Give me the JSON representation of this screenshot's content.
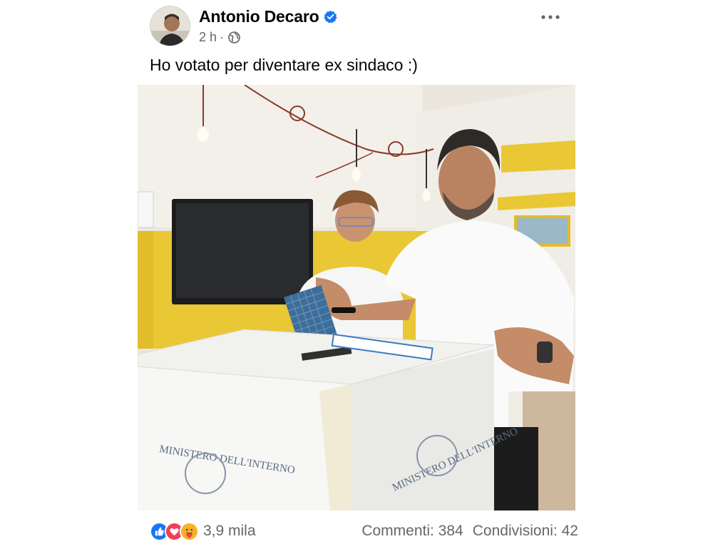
{
  "post": {
    "author": {
      "name": "Antonio Decaro",
      "verified": true
    },
    "meta": {
      "time": "2 h",
      "separator": "·",
      "audience_icon": "globe-icon"
    },
    "more_icon": "more-options-icon",
    "text": "Ho votato per diventare ex sindaco :)",
    "photo": {
      "box_text_left": "MINISTERO DELL'INTERNO",
      "box_text_right": "MINISTERO DELL'INTERNO"
    }
  },
  "footer": {
    "reactions": [
      "like-icon",
      "love-icon",
      "care-icon"
    ],
    "reaction_count": "3,9 mila",
    "comments": "Commenti: 384",
    "shares": "Condivisioni: 42"
  },
  "colors": {
    "brand_blue": "#1877f2",
    "love_red": "#f33e58",
    "care_yellow": "#f7b125",
    "secondary_text": "#65676b"
  }
}
